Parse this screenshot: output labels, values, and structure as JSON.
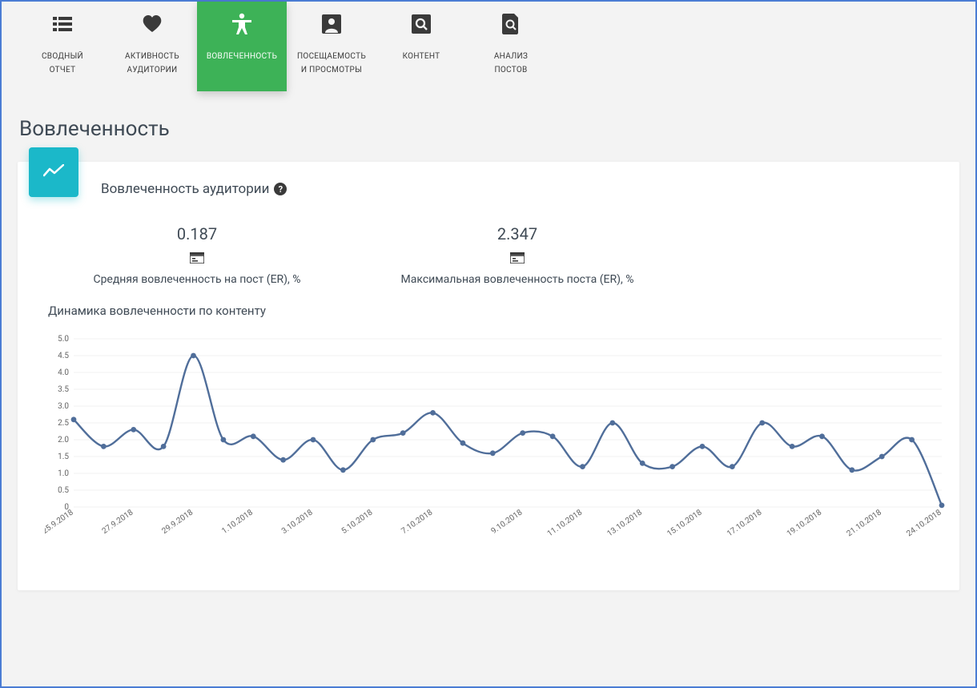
{
  "tabs": [
    {
      "label1": "СВОДНЫЙ",
      "label2": "ОТЧЕТ",
      "icon": "list-icon"
    },
    {
      "label1": "АКТИВНОСТЬ",
      "label2": "АУДИТОРИИ",
      "icon": "heart-icon"
    },
    {
      "label1": "ВОВЛЕЧЕННОСТЬ",
      "label2": "",
      "icon": "accessibility-icon",
      "active": true
    },
    {
      "label1": "ПОСЕЩАЕМОСТЬ",
      "label2": "И ПРОСМОТРЫ",
      "icon": "person-square-icon"
    },
    {
      "label1": "КОНТЕНТ",
      "label2": "",
      "icon": "zoom-square-icon"
    },
    {
      "label1": "АНАЛИЗ",
      "label2": "ПОСТОВ",
      "icon": "zoom-page-icon"
    }
  ],
  "page": {
    "title": "Вовлеченность"
  },
  "card": {
    "title": "Вовлеченность аудитории",
    "stats": [
      {
        "value": "0.187",
        "label": "Средняя вовлеченность на пост (ER), %"
      },
      {
        "value": "2.347",
        "label": "Максимальная вовлеченность поста (ER), %"
      }
    ],
    "chart_title": "Динамика вовлеченности по контенту"
  },
  "chart_data": {
    "type": "line",
    "title": "Динамика вовлеченности по контенту",
    "xlabel": "",
    "ylabel": "",
    "ylim": [
      0,
      5.0
    ],
    "y_ticks": [
      0,
      0.5,
      1.0,
      1.5,
      2.0,
      2.5,
      3.0,
      3.5,
      4.0,
      4.5,
      5.0
    ],
    "x_tick_labels": [
      "25.9.2018",
      "27.9.2018",
      "29.9.2018",
      "1.10.2018",
      "3.10.2018",
      "5.10.2018",
      "7.10.2018",
      "9.10.2018",
      "11.10.2018",
      "13.10.2018",
      "15.10.2018",
      "17.10.2018",
      "19.10.2018",
      "21.10.2018",
      "24.10.2018"
    ],
    "series": [
      {
        "name": "ER",
        "color": "#506e9a",
        "values": [
          2.6,
          1.8,
          2.3,
          1.8,
          4.5,
          2.0,
          2.1,
          1.4,
          2.0,
          1.1,
          2.0,
          2.2,
          2.8,
          1.9,
          1.6,
          2.2,
          2.1,
          1.2,
          2.5,
          1.3,
          1.2,
          1.8,
          1.2,
          2.5,
          1.8,
          2.1,
          1.1,
          1.5,
          2.0,
          0.05
        ]
      }
    ]
  }
}
